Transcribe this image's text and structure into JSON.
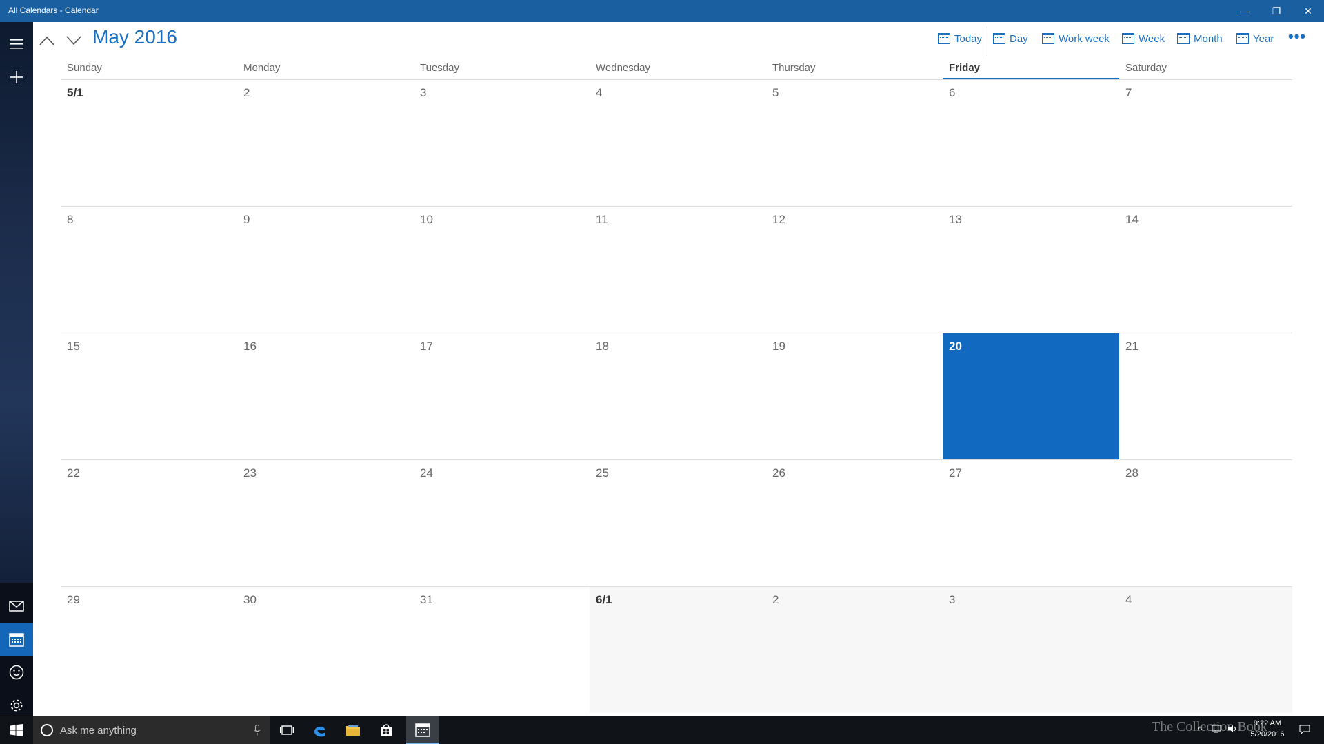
{
  "window": {
    "title": "All Calendars - Calendar",
    "minimize_glyph": "—",
    "maximize_glyph": "❐",
    "close_glyph": "✕"
  },
  "header": {
    "month_title": "May 2016",
    "views": [
      {
        "label": "Today",
        "icon": "today-icon"
      },
      {
        "label": "Day",
        "icon": "day-view-icon"
      },
      {
        "label": "Work week",
        "icon": "work-week-icon"
      },
      {
        "label": "Week",
        "icon": "week-view-icon"
      },
      {
        "label": "Month",
        "icon": "month-view-icon"
      },
      {
        "label": "Year",
        "icon": "year-view-icon"
      }
    ],
    "more_glyph": "•••"
  },
  "day_headers": [
    "Sunday",
    "Monday",
    "Tuesday",
    "Wednesday",
    "Thursday",
    "Friday",
    "Saturday"
  ],
  "current_weekday": "Friday",
  "weeks": [
    [
      "5/1",
      "2",
      "3",
      "4",
      "5",
      "6",
      "7"
    ],
    [
      "8",
      "9",
      "10",
      "11",
      "12",
      "13",
      "14"
    ],
    [
      "15",
      "16",
      "17",
      "18",
      "19",
      "20",
      "21"
    ],
    [
      "22",
      "23",
      "24",
      "25",
      "26",
      "27",
      "28"
    ],
    [
      "29",
      "30",
      "31",
      "6/1",
      "2",
      "3",
      "4"
    ]
  ],
  "today": "20",
  "taskbar": {
    "search_placeholder": "Ask me anything",
    "watermark": "The Collection Book",
    "time": "9:22 AM",
    "date": "5/20/2016"
  },
  "colors": {
    "accent": "#1a6fc0",
    "today_fill": "#1169c0",
    "titlebar": "#1a5fa0"
  }
}
